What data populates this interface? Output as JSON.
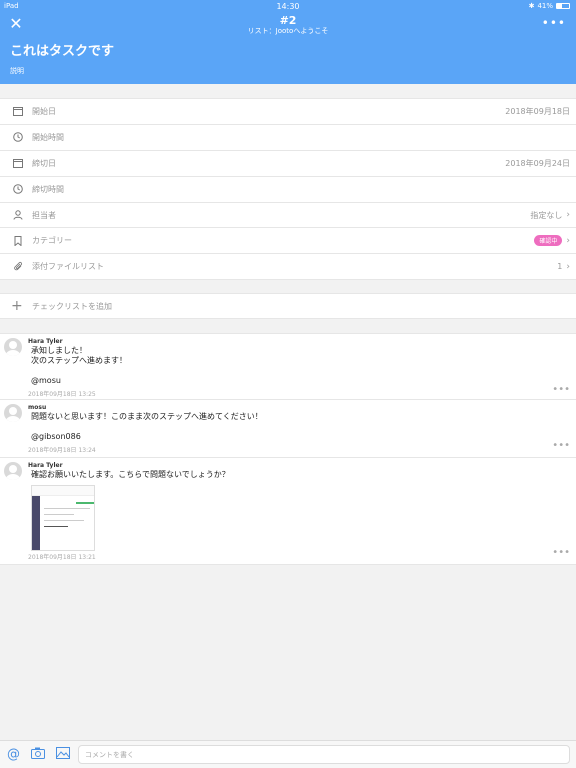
{
  "status": {
    "device": "iPad",
    "time": "14:30",
    "battery": "41%"
  },
  "header": {
    "task_number": "#2",
    "list_label": "リスト：Jootoへようこそ",
    "title": "これはタスクです",
    "description": "説明"
  },
  "fields": [
    {
      "icon": "calendar-icon",
      "label": "開始日",
      "value": "2018年09月18日"
    },
    {
      "icon": "clock-icon",
      "label": "開始時間",
      "value": ""
    },
    {
      "icon": "calendar-icon",
      "label": "締切日",
      "value": "2018年09月24日"
    },
    {
      "icon": "clock-icon",
      "label": "締切時間",
      "value": ""
    },
    {
      "icon": "person-icon",
      "label": "担当者",
      "value": "指定なし"
    },
    {
      "icon": "bookmark-icon",
      "label": "カテゴリー",
      "badge": "確認中"
    },
    {
      "icon": "paperclip-icon",
      "label": "添付ファイルリスト",
      "value": "1"
    }
  ],
  "checklist": {
    "add_label": "チェックリストを追加"
  },
  "comments": [
    {
      "author": "Hara Tyler",
      "body": "承知しました！\n次のステップへ進めます！\n\n@mosu",
      "time": "2018年09月18日 13:25"
    },
    {
      "author": "mosu",
      "body": "問題ないと思います！このまま次のステップへ進めてください！\n\n@gibson086",
      "time": "2018年09月18日 13:24"
    },
    {
      "author": "Hara Tyler",
      "body": "確認お願いいたします。こちらで問題ないでしょうか？",
      "time": "2018年09月18日 13:21"
    }
  ],
  "bottom_bar": {
    "placeholder": "コメントを書く"
  },
  "colors": {
    "header": "#5aa5f7",
    "badge": "#ee6dbf",
    "accent": "#4a90e2"
  }
}
